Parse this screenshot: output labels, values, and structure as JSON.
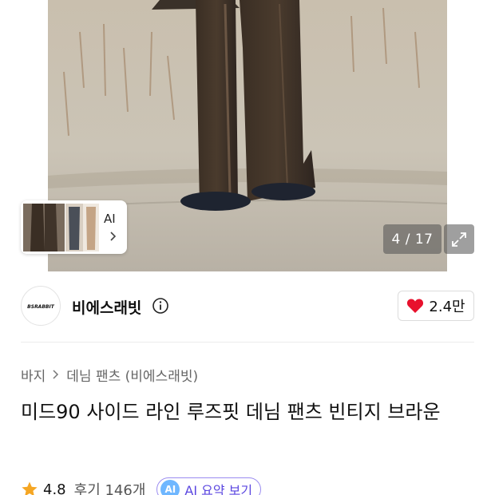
{
  "gallery": {
    "thumb_ai_label": "AI",
    "counter": "4 / 17"
  },
  "brand": {
    "name": "비에스래빗",
    "logo_text": "BSRABBIT",
    "like_count": "2.4만"
  },
  "breadcrumb": {
    "items": [
      "바지",
      "데님 팬츠 (비에스래빗)"
    ]
  },
  "product": {
    "title": "미드90 사이드 라인 루즈핏 데님 팬츠 빈티지 브라운"
  },
  "rating": {
    "value": "4.8",
    "reviews": "후기 146개",
    "ai_summary_badge": "AI",
    "ai_summary_label": "AI 요약 보기"
  },
  "colors": {
    "like_heart": "#e8112d",
    "star": "#f5a623",
    "ai_chip": "#5b47e0"
  }
}
